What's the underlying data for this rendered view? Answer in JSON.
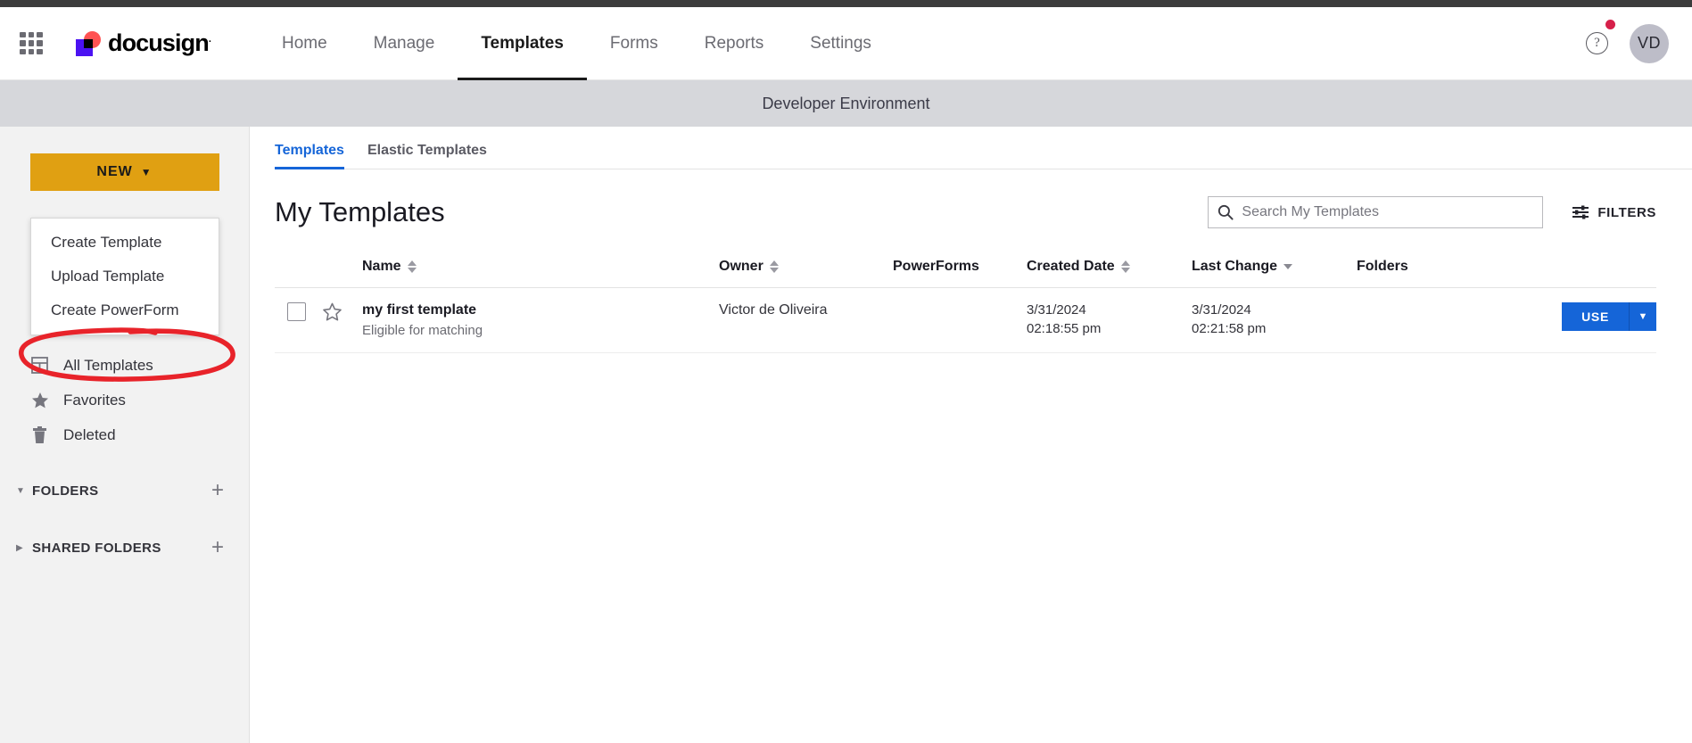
{
  "browser": {
    "chrome_bar_color": "#3c3c3c"
  },
  "header": {
    "apps_icon": "apps-grid-icon",
    "brand": {
      "name": "docusign",
      "trademark": "."
    },
    "nav": [
      {
        "label": "Home",
        "active": false
      },
      {
        "label": "Manage",
        "active": false
      },
      {
        "label": "Templates",
        "active": true
      },
      {
        "label": "Forms",
        "active": false
      },
      {
        "label": "Reports",
        "active": false
      },
      {
        "label": "Settings",
        "active": false
      }
    ],
    "help_icon_label": "?",
    "notification_dot_color": "#d6204a",
    "avatar_initials": "VD"
  },
  "env_banner": {
    "text": "Developer Environment",
    "background": "#d6d7db"
  },
  "sidebar": {
    "new_button": {
      "label": "NEW",
      "caret": "▼",
      "color": "#e0a012"
    },
    "new_menu": [
      {
        "label": "Create Template",
        "highlighted": true
      },
      {
        "label": "Upload Template",
        "highlighted": false
      },
      {
        "label": "Create PowerForm",
        "highlighted": false
      }
    ],
    "annotation": {
      "shape": "hand-drawn-ellipse",
      "color": "#e8232a",
      "targets": "Create Template"
    },
    "links": [
      {
        "label": "All Templates",
        "icon": "templates-grid-icon"
      },
      {
        "label": "Favorites",
        "icon": "star-icon"
      },
      {
        "label": "Deleted",
        "icon": "trash-icon"
      }
    ],
    "sections": [
      {
        "label": "FOLDERS",
        "expanded": true,
        "caret": "▼",
        "add": "+"
      },
      {
        "label": "SHARED FOLDERS",
        "expanded": false,
        "caret": "▶",
        "add": "+"
      }
    ]
  },
  "main": {
    "tabs": [
      {
        "label": "Templates",
        "active": true
      },
      {
        "label": "Elastic Templates",
        "active": false
      }
    ],
    "title": "My Templates",
    "search": {
      "placeholder": "Search My Templates",
      "value": "",
      "icon": "search-icon"
    },
    "filters": {
      "label": "FILTERS",
      "icon": "filter-sliders-icon"
    },
    "table": {
      "columns": [
        {
          "label": "Name",
          "sort": "both"
        },
        {
          "label": "Owner",
          "sort": "both"
        },
        {
          "label": "PowerForms",
          "sort": "none"
        },
        {
          "label": "Created Date",
          "sort": "both"
        },
        {
          "label": "Last Change",
          "sort": "desc"
        },
        {
          "label": "Folders",
          "sort": "none"
        }
      ],
      "rows": [
        {
          "selected": false,
          "favorite": false,
          "name": "my first template",
          "subtitle": "Eligible for matching",
          "owner": "Victor de Oliveira",
          "powerforms": "",
          "created_date": "3/31/2024",
          "created_time": "02:18:55 pm",
          "last_change_date": "3/31/2024",
          "last_change_time": "02:21:58 pm",
          "folders": "",
          "action_label": "USE",
          "action_caret": "▼"
        }
      ]
    }
  }
}
